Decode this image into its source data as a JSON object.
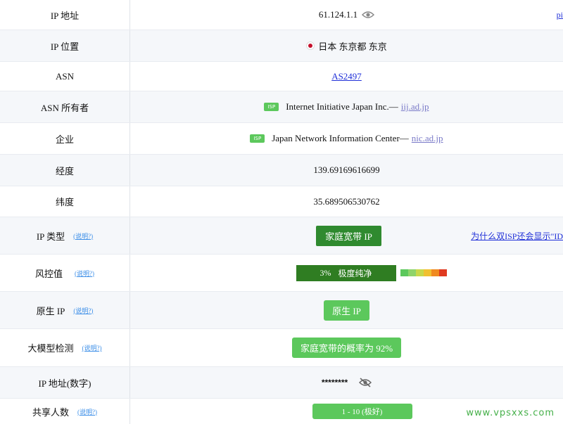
{
  "rows": [
    {
      "label": "IP 地址",
      "value": "61.124.1.1",
      "extra": "pi"
    },
    {
      "label": "IP 位置",
      "value": "日本 东京都 东京"
    },
    {
      "label": "ASN",
      "value": "AS2497"
    },
    {
      "label": "ASN 所有者",
      "badge": "ISP",
      "value": "Internet Initiative Japan Inc.—",
      "domain": "iij.ad.jp"
    },
    {
      "label": "企业",
      "badge": "ISP",
      "value": "Japan Network Information Center—",
      "domain": "nic.ad.jp"
    },
    {
      "label": "经度",
      "value": "139.69169616699"
    },
    {
      "label": "纬度",
      "value": "35.689506530762"
    },
    {
      "label": "IP 类型",
      "help": "(说明?)",
      "value": "家庭宽带 IP",
      "extra": "为什么双ISP还会显示\"ID"
    },
    {
      "label": "风控值",
      "help": "(说明?)",
      "percent": "3%",
      "value": "极度纯净",
      "risk_fraction": 0.03
    },
    {
      "label": "原生 IP",
      "help": "(说明?)",
      "value": "原生 IP"
    },
    {
      "label": "大模型检测",
      "help": "(说明?)",
      "value": "家庭宽带的概率为 92%"
    },
    {
      "label": "IP 地址(数字)",
      "value": "********"
    },
    {
      "label": "共享人数",
      "help": "(说明?)",
      "value": "1 - 10 (极好)"
    }
  ],
  "colors": {
    "badge_green": "#5cc85c",
    "button_dark_green": "#2f8a2f",
    "risk_scale": [
      "#5cc85c",
      "#8fd46a",
      "#c8d84a",
      "#f0c030",
      "#f08a20",
      "#e03a20"
    ]
  },
  "watermark": "www.vpsxxs.com"
}
